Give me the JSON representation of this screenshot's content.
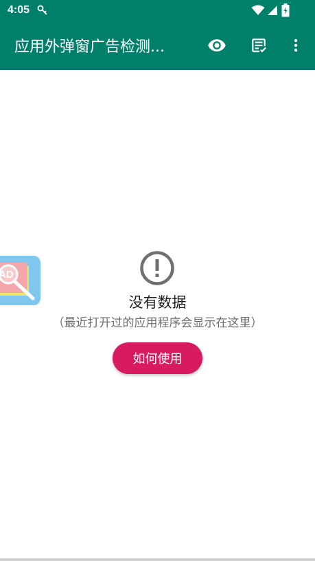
{
  "status_bar": {
    "time": "4:05"
  },
  "app_bar": {
    "title": "应用外弹窗广告检测...",
    "actions": [
      "eye-icon",
      "checklist-icon",
      "more-vert-icon"
    ]
  },
  "empty_state": {
    "icon": "alert-circle-icon",
    "title": "没有数据",
    "subtitle": "（最近打开过的应用程序会显示在这里）",
    "button_label": "如何使用"
  },
  "floating_badge": {
    "text": "AD"
  },
  "colors": {
    "primary": "#00806a",
    "accent": "#d81b60",
    "icon_gray": "#707070"
  }
}
